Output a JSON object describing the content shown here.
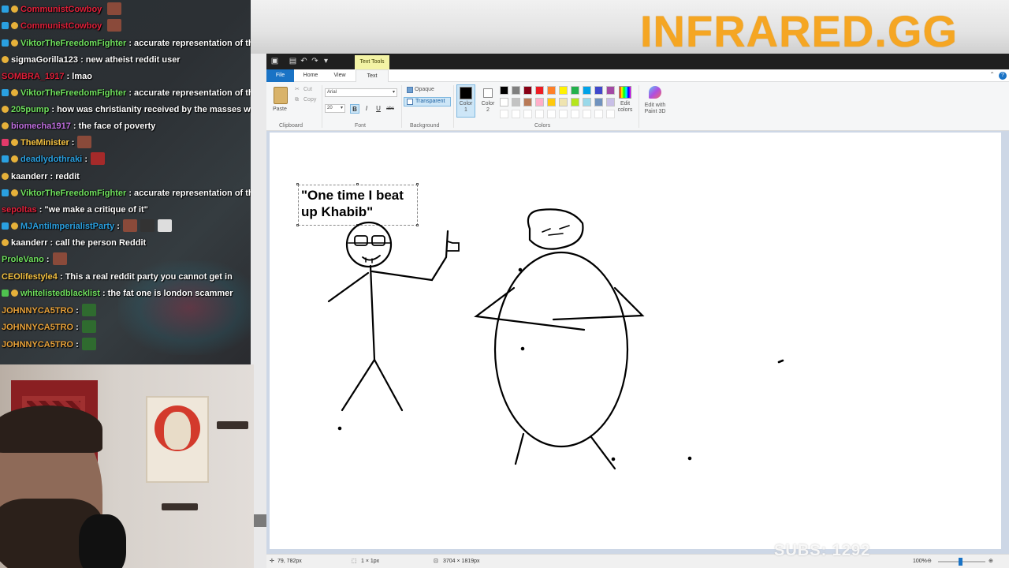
{
  "overlay": {
    "brand": "INFRARED.GG",
    "subs": "SUBS: 1292"
  },
  "chat": {
    "messages": [
      {
        "user": "CommunistCowboy",
        "color": "#e0203a",
        "badges": [
          "b1",
          "b2"
        ],
        "text": "",
        "emotes": 1
      },
      {
        "user": "CommunistCowboy",
        "color": "#e0203a",
        "badges": [
          "b1",
          "b2"
        ],
        "text": "",
        "emotes": 1
      },
      {
        "user": "ViktorTheFreedomFighter",
        "color": "#6fe05e",
        "badges": [
          "b1",
          "b2"
        ],
        "text": ": accurate representation of the a",
        "emotes": 0
      },
      {
        "user": "sigmaGorilla123",
        "color": "#ffffff",
        "badges": [
          "b2"
        ],
        "text": ": new atheist reddit user",
        "emotes": 0
      },
      {
        "user": "SOMBRA_1917",
        "color": "#e0203a",
        "badges": [],
        "text": ": lmao",
        "emotes": 0
      },
      {
        "user": "ViktorTheFreedomFighter",
        "color": "#6fe05e",
        "badges": [
          "b1",
          "b2"
        ],
        "text": ": accurate representation of the a",
        "emotes": 0
      },
      {
        "user": "205pump",
        "color": "#6fe05e",
        "badges": [
          "b2"
        ],
        "text": ": how was christianity received by the masses whe",
        "emotes": 0
      },
      {
        "user": "biomecha1917",
        "color": "#c06fe0",
        "badges": [
          "b2"
        ],
        "text": ": the face of poverty",
        "emotes": 0
      },
      {
        "user": "TheMinister",
        "color": "#f5c242",
        "badges": [
          "b3",
          "b2"
        ],
        "text": ":",
        "emotes": 1
      },
      {
        "user": "deadlydothraki",
        "color": "#2aa0e0",
        "badges": [
          "b1",
          "b2"
        ],
        "text": ":",
        "emotes": 1
      },
      {
        "user": "kaanderr",
        "color": "#ffffff",
        "badges": [
          "b2"
        ],
        "text": ": reddit",
        "emotes": 0
      },
      {
        "user": "ViktorTheFreedomFighter",
        "color": "#6fe05e",
        "badges": [
          "b1",
          "b2"
        ],
        "text": ": accurate representation of the a",
        "emotes": 0
      },
      {
        "user": "sepoltas",
        "color": "#e0203a",
        "badges": [],
        "text": ": \"we make a critique of it\"",
        "emotes": 0
      },
      {
        "user": "MJAntiImperialistParty",
        "color": "#2aa0e0",
        "badges": [
          "b1",
          "b2"
        ],
        "text": ":",
        "emotes": 3
      },
      {
        "user": "kaanderr",
        "color": "#ffffff",
        "badges": [
          "b2"
        ],
        "text": ": call the person Reddit",
        "emotes": 0
      },
      {
        "user": "ProleVano",
        "color": "#6fe05e",
        "badges": [],
        "text": ":",
        "emotes": 1
      },
      {
        "user": "CEOlifestyle4",
        "color": "#f5c242",
        "badges": [],
        "text": ": This a real reddit party you cannot get in",
        "emotes": 0
      },
      {
        "user": "whitelistedblacklist",
        "color": "#6fe05e",
        "badges": [
          "b4",
          "b2"
        ],
        "text": ": the fat one is london scammer",
        "emotes": 0
      },
      {
        "user": "JOHNNYCA5TRO",
        "color": "#e8a23a",
        "badges": [],
        "text": ":",
        "emotes": 1
      },
      {
        "user": "JOHNNYCA5TRO",
        "color": "#e8a23a",
        "badges": [],
        "text": ":",
        "emotes": 1
      },
      {
        "user": "JOHNNYCA5TRO",
        "color": "#e8a23a",
        "badges": [],
        "text": ":",
        "emotes": 1
      }
    ]
  },
  "paint": {
    "context_tab": "Text Tools",
    "tabs": {
      "file": "File",
      "home": "Home",
      "view": "View",
      "text": "Text"
    },
    "clipboard": {
      "paste": "Paste",
      "cut": "Cut",
      "copy": "Copy",
      "label": "Clipboard"
    },
    "font": {
      "family": "Arial",
      "size": "20",
      "bold": "B",
      "italic": "I",
      "underline": "U",
      "strike": "abc",
      "label": "Font"
    },
    "background": {
      "opaque": "Opaque",
      "transparent": "Transparent",
      "label": "Background"
    },
    "colors": {
      "color1": "Color\n1",
      "color2": "Color\n2",
      "edit": "Edit\ncolors",
      "label": "Colors",
      "palette": [
        "#000000",
        "#7f7f7f",
        "#880015",
        "#ed1c24",
        "#ff7f27",
        "#fff200",
        "#22b14c",
        "#00a2e8",
        "#3f48cc",
        "#a349a4",
        "#ffffff",
        "#c3c3c3",
        "#b97a57",
        "#ffaec9",
        "#ffc90e",
        "#efe4b0",
        "#b5e61d",
        "#99d9ea",
        "#7092be",
        "#c8bfe7"
      ]
    },
    "paint3d": "Edit with\nPaint 3D",
    "caption": "\"One time I beat up Khabib\"",
    "status": {
      "cursor": "79, 782px",
      "selection": "1 × 1px",
      "size": "3704 × 1819px",
      "zoom": "100%"
    }
  }
}
